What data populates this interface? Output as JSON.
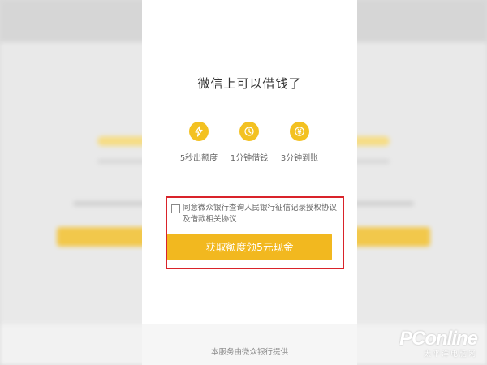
{
  "title": "微信上可以借钱了",
  "features": [
    {
      "icon": "lightning-icon",
      "label": "5秒出额度"
    },
    {
      "icon": "clock-icon",
      "label": "1分钟借钱"
    },
    {
      "icon": "yen-icon",
      "label": "3分钟到账"
    }
  ],
  "agreement": {
    "text": "同意微众银行查询人民银行征信记录授权协议及借款相关协议",
    "checked": false
  },
  "cta_label": "获取额度领5元现金",
  "footer_text": "本服务由微众银行提供",
  "watermark": {
    "brand": "PConline",
    "sub": "太平洋电脑网"
  },
  "colors": {
    "accent": "#f2b81f",
    "icon_bg": "#f3c121",
    "highlight": "#d9232a"
  }
}
